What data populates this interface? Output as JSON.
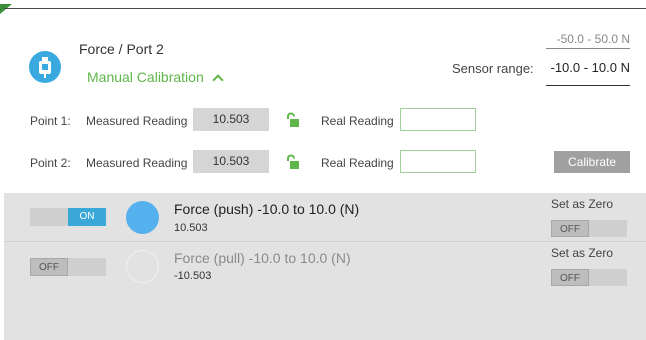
{
  "header": {
    "title": "Force / Port 2",
    "calibration_toggle": "Manual Calibration",
    "sensor_range_label": "Sensor range:",
    "range_alt": "-50.0 - 50.0 N",
    "range_selected": "-10.0 - 10.0 N",
    "icon": "force-sensor-icon"
  },
  "calibration": {
    "points": [
      {
        "label": "Point 1:",
        "measured_label": "Measured Reading",
        "measured_value": "10.503",
        "real_label": "Real Reading",
        "real_value": ""
      },
      {
        "label": "Point 2:",
        "measured_label": "Measured Reading",
        "measured_value": "10.503",
        "real_label": "Real Reading",
        "real_value": ""
      }
    ],
    "calibrate_label": "Calibrate"
  },
  "sensors": [
    {
      "toggle": "ON",
      "name": "Force (push) -10.0 to 10.0 (N)",
      "value": "10.503",
      "zero_label": "Set as Zero",
      "zero_toggle": "OFF"
    },
    {
      "toggle": "OFF",
      "name": "Force (pull) -10.0 to 10.0 (N)",
      "value": "-10.503",
      "zero_label": "Set as Zero",
      "zero_toggle": "OFF"
    }
  ],
  "colors": {
    "accent_green": "#5fb64a",
    "accent_blue": "#3aa9d9",
    "sensor_dot": "#55b0ee",
    "panel_bg": "#e2e2e2"
  }
}
